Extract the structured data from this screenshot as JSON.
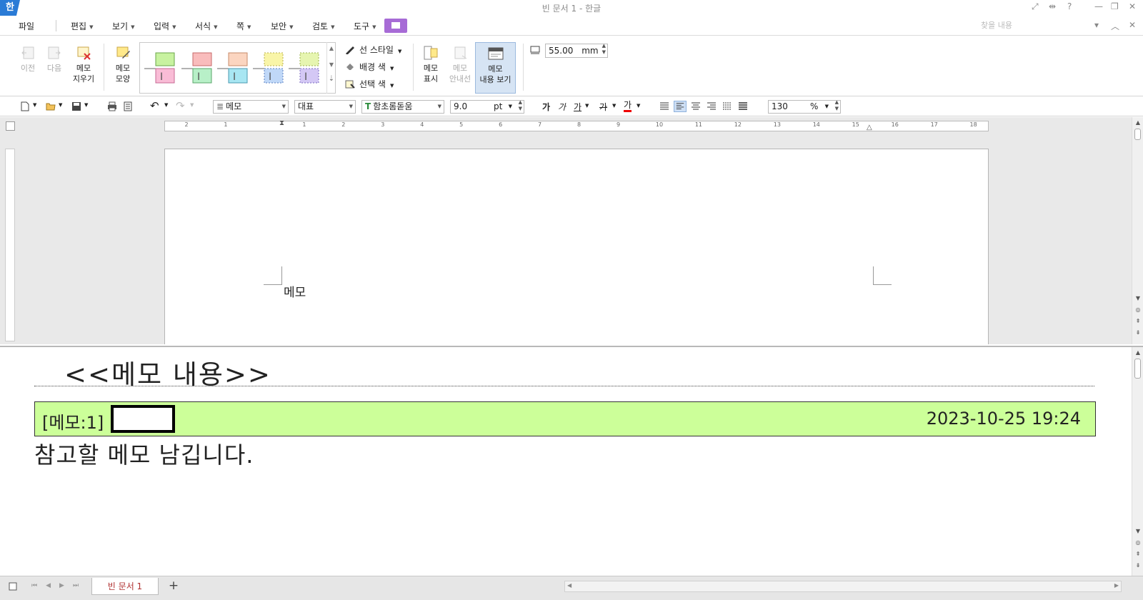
{
  "window": {
    "title": "빈 문서 1 - 한글",
    "app_logo": "한",
    "controls": [
      "minimize-icon",
      "restore-icon",
      "close-icon"
    ]
  },
  "menu": {
    "file": "파일",
    "items": [
      {
        "label": "편집"
      },
      {
        "label": "보기"
      },
      {
        "label": "입력"
      },
      {
        "label": "서식"
      },
      {
        "label": "쪽"
      },
      {
        "label": "보안"
      },
      {
        "label": "검토"
      },
      {
        "label": "도구"
      }
    ],
    "search_placeholder": "찾을 내용"
  },
  "ribbon": {
    "prev": "이전",
    "next": "다음",
    "delete_memo": [
      "메모",
      "지우기"
    ],
    "memo_shape": [
      "메모",
      "모양"
    ],
    "line_style": "선 스타일",
    "bg_color": "배경 색",
    "select_color": "선택 색",
    "show_memo": [
      "메모",
      "표시"
    ],
    "memo_guide": [
      "메모",
      "안내선"
    ],
    "view_memo_content": [
      "메모",
      "내용 보기"
    ],
    "memo_width_value": "55.00",
    "memo_width_unit": "mm"
  },
  "toolbar": {
    "style": "메모",
    "lang": "대표",
    "font": "함초롬돋움",
    "font_size": "9.0",
    "font_unit": "pt",
    "bold": "가",
    "italic": "가",
    "underline": "가",
    "strike": "가",
    "font_color": "가",
    "zoom_value": "130",
    "zoom_unit": "%"
  },
  "ruler": {
    "ticks": [
      "2",
      "1",
      "",
      "1",
      "2",
      "3",
      "4",
      "5",
      "6",
      "7",
      "8",
      "9",
      "10",
      "11",
      "12",
      "13",
      "14",
      "15",
      "16",
      "17",
      "18"
    ]
  },
  "document": {
    "body_text": "메모"
  },
  "memo_pane": {
    "heading": "<<메모 내용>>",
    "memo_id": "[메모:1]",
    "datetime": "2023-10-25 19:24",
    "content": "참고할 메모 남깁니다.",
    "bar_color": "#ccff99"
  },
  "status": {
    "tab_label": "빈 문서 1",
    "add_tab": "+"
  }
}
